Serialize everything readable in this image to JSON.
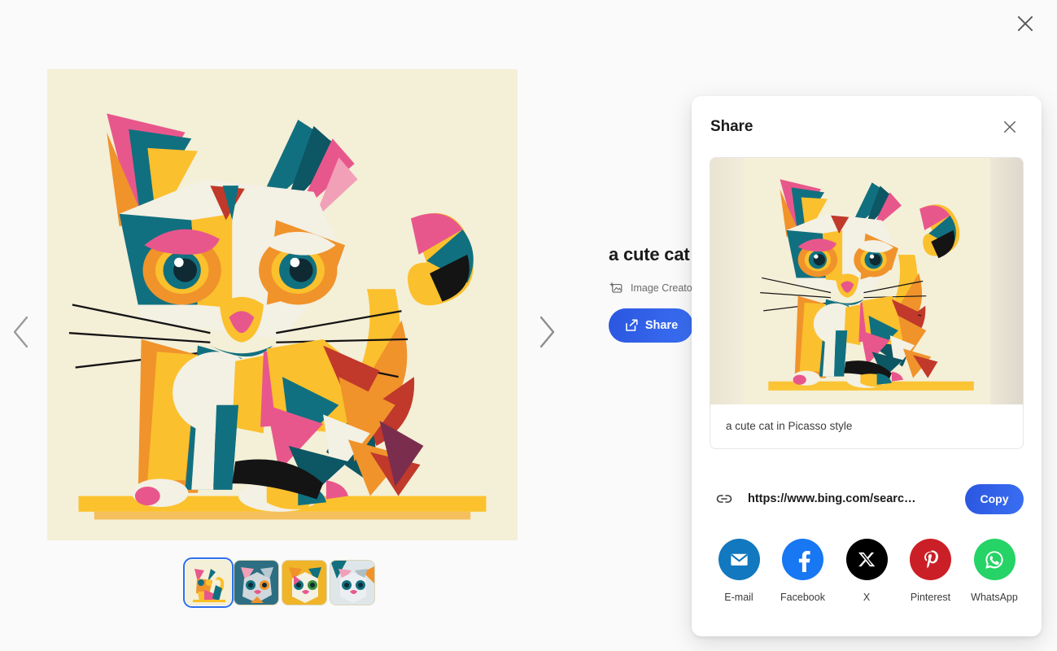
{
  "page": {
    "background_color": "#fafafa",
    "close_label": "Close",
    "close_icon": "close-x-icon"
  },
  "viewer": {
    "prev_icon": "chevron-left-icon",
    "next_icon": "chevron-right-icon",
    "image_alt": "a cute cat in Picasso style",
    "thumbnails": [
      {
        "alt": "cubist cat full body sitting",
        "selected": true
      },
      {
        "alt": "cubist cat face teal background",
        "selected": false
      },
      {
        "alt": "cubist cat face yellow background",
        "selected": false
      },
      {
        "alt": "cubist cat face grey white",
        "selected": false
      }
    ]
  },
  "detail": {
    "title": "a cute cat i",
    "attribution": "Image Creator in",
    "attribution_icon": "sparkle-image-icon",
    "share_label": "Share",
    "share_icon": "share-export-icon",
    "accent_color": "#2f62ec"
  },
  "dialog": {
    "title": "Share",
    "close_icon": "close-x-icon",
    "preview": {
      "image_alt": "a cute cat in Picasso style",
      "caption": "a cute cat in Picasso style"
    },
    "link": {
      "icon": "link-chain-icon",
      "url": "https://www.bing.com/searc…",
      "copy_label": "Copy",
      "copy_color": "#2f62ec"
    },
    "socials": [
      {
        "label": "E-mail",
        "icon": "email-envelope-icon",
        "color": "#1278bf"
      },
      {
        "label": "Facebook",
        "icon": "facebook-icon",
        "color": "#1877f2"
      },
      {
        "label": "X",
        "icon": "x-twitter-icon",
        "color": "#000000"
      },
      {
        "label": "Pinterest",
        "icon": "pinterest-icon",
        "color": "#cb1f27"
      },
      {
        "label": "WhatsApp",
        "icon": "whatsapp-icon",
        "color": "#25d366"
      }
    ]
  },
  "artwork": {
    "bg": "#f4efd7",
    "teal": "#11707f",
    "teal_dark": "#0d5663",
    "orange": "#f0932b",
    "orange_deep": "#e2761b",
    "yellow": "#fbc02d",
    "pink": "#e8578c",
    "pink_soft": "#f2a0b8",
    "cream": "#f3f0e4",
    "red": "#c0392b",
    "black": "#141414",
    "plum": "#7b2d4e"
  }
}
